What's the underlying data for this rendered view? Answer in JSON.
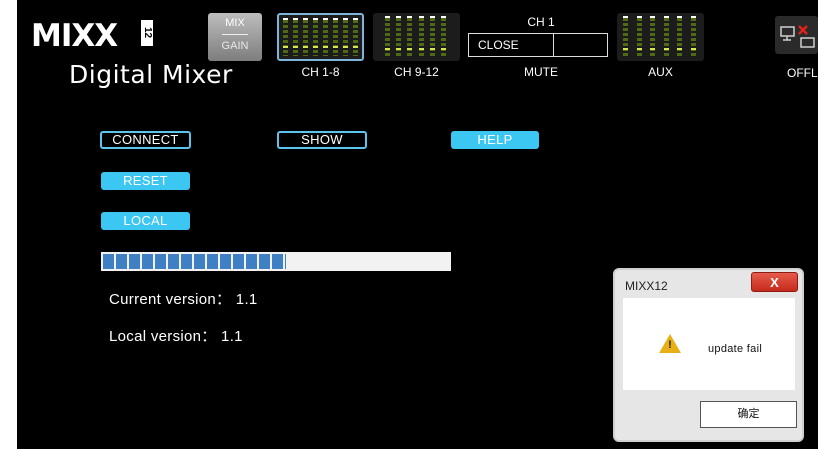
{
  "header": {
    "logo": "MIXX",
    "logo_number": "12",
    "subtitle": "Digital Mixer",
    "mix_gain": {
      "top": "MIX",
      "bottom": "GAIN"
    },
    "meters": [
      {
        "label": "CH 1-8",
        "bars": 8,
        "selected": true
      },
      {
        "label": "CH 9-12",
        "bars": 6,
        "selected": false
      },
      {
        "label": "AUX",
        "bars": 6,
        "selected": false
      }
    ],
    "channel": {
      "title": "CH 1",
      "close_label": "CLOSE",
      "mute_label": "MUTE"
    },
    "status": "OFFL"
  },
  "buttons": {
    "connect": "CONNECT",
    "show": "SHOW",
    "help": "HELP",
    "reset": "RESET",
    "local": "LOCAL"
  },
  "progress": {
    "segments_filled": 12,
    "fraction": 0.53
  },
  "versions": {
    "current": "Current version： 1.1",
    "local": "Local version： 1.1"
  },
  "dialog": {
    "title": "MIXX12",
    "close_glyph": "X",
    "message": "update fail",
    "ok_label": "确定"
  },
  "colors": {
    "accent": "#3cc6f2",
    "progress": "#3f7fc4",
    "meter_green": "#4e6a12",
    "close_red": "#d23b2c"
  }
}
